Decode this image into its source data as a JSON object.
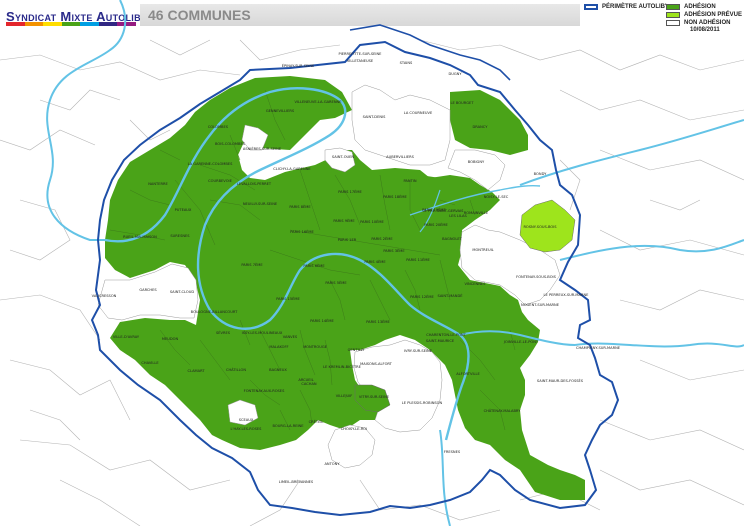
{
  "header": {
    "logo_text": "Syndicat Mixte Autolib'",
    "title": "46 COMMUNES",
    "date": "10/08/2011"
  },
  "legend": {
    "perimeter_label": "PÉRIMÈTRE AUTOLIB'",
    "items": [
      {
        "label": "ADHÉSION",
        "color": "#4aa318"
      },
      {
        "label": "ADHÉSION PRÉVUE",
        "color": "#9ee41c"
      },
      {
        "label": "NON ADHÉSION",
        "color": "#ffffff"
      }
    ],
    "perimeter_color": "#1e4fa8"
  },
  "map": {
    "colors": {
      "adhesion": "#4aa318",
      "prevue": "#9ee41c",
      "river": "#63c3e6",
      "perimeter": "#1e4fa8",
      "border": "#9a9a9a"
    },
    "labels": [
      {
        "t": "PIERREFITTE-SUR-SEINE"
      },
      {
        "t": "VILLETANEUSE"
      },
      {
        "t": "STAINS"
      },
      {
        "t": "DUGNY"
      },
      {
        "t": "ÉPINAY-SUR-SEINE"
      },
      {
        "t": "GENNEVILLIERS"
      },
      {
        "t": "VILLENEUVE-LA-GARENNE"
      },
      {
        "t": "LE BOURGET"
      },
      {
        "t": "LA COURNEUVE"
      },
      {
        "t": "SAINT-DENIS"
      },
      {
        "t": "COLOMBES"
      },
      {
        "t": "BOIS-COLOMBES"
      },
      {
        "t": "ASNIÈRES-SUR-SEINE"
      },
      {
        "t": "DRANCY"
      },
      {
        "t": "AUBERVILLIERS"
      },
      {
        "t": "BOBIGNY"
      },
      {
        "t": "LA GARENNE-COLOMBES"
      },
      {
        "t": "SAINT-OUEN"
      },
      {
        "t": "CLICHY-LA-GARENNE"
      },
      {
        "t": "COURBEVOIE"
      },
      {
        "t": "NANTERRE"
      },
      {
        "t": "LEVALLOIS-PERRET"
      },
      {
        "t": "PANTIN"
      },
      {
        "t": "BONDY"
      },
      {
        "t": "NEUILLY-SUR-SEINE"
      },
      {
        "t": "PARIS 17ÈME"
      },
      {
        "t": "PARIS 18ÈME"
      },
      {
        "t": "PARIS 19ÈME"
      },
      {
        "t": "PUTEAUX"
      },
      {
        "t": "NOISY-LE-SEC"
      },
      {
        "t": "LE PRÉ-SAINT-GERVAIS"
      },
      {
        "t": "LES LILAS"
      },
      {
        "t": "ROMAINVILLE"
      },
      {
        "t": "PARIS 8ÈME"
      },
      {
        "t": "PARIS 9ÈME"
      },
      {
        "t": "PARIS 10ÈME"
      },
      {
        "t": "PARIS 20ÈME"
      },
      {
        "t": "SURESNES"
      },
      {
        "t": "RUEIL-MALMAISON"
      },
      {
        "t": "PARIS 16ÈME"
      },
      {
        "t": "PARIS 1ER"
      },
      {
        "t": "PARIS 2ÈME"
      },
      {
        "t": "PARIS 3ÈME"
      },
      {
        "t": "BAGNOLET"
      },
      {
        "t": "ROSNY-SOUS-BOIS"
      },
      {
        "t": "PARIS 7ÈME"
      },
      {
        "t": "PARIS 4ÈME"
      },
      {
        "t": "PARIS 11ÈME"
      },
      {
        "t": "MONTREUIL"
      },
      {
        "t": "FONTENAY-SOUS-BOIS"
      },
      {
        "t": "PARIS 6ÈME"
      },
      {
        "t": "PARIS 5ÈME"
      },
      {
        "t": "VINCENNES"
      },
      {
        "t": "GARCHES"
      },
      {
        "t": "SAINT-CLOUD"
      },
      {
        "t": "PARIS 15ÈME"
      },
      {
        "t": "PARIS 12ÈME"
      },
      {
        "t": "SAINT-MANDÉ"
      },
      {
        "t": "LE PERREUX-SUR-MARNE"
      },
      {
        "t": "VAUCRESSON"
      },
      {
        "t": "BOULOGNE-BILLANCOURT"
      },
      {
        "t": "PARIS 14ÈME"
      },
      {
        "t": "PARIS 13ÈME"
      },
      {
        "t": "NOGENT-SUR-MARNE"
      },
      {
        "t": "SÈVRES"
      },
      {
        "t": "ISSY-LES-MOULINEAUX"
      },
      {
        "t": "VANVES"
      },
      {
        "t": "CHARENTON-LE-PONT"
      },
      {
        "t": "SAINT-MAURICE"
      },
      {
        "t": "JOINVILLE-LE-PONT"
      },
      {
        "t": "VILLE-D'AVRAY"
      },
      {
        "t": "MEUDON"
      },
      {
        "t": "MALAKOFF"
      },
      {
        "t": "MONTROUGE"
      },
      {
        "t": "GENTILLY"
      },
      {
        "t": "IVRY-SUR-SEINE"
      },
      {
        "t": "CHAMPIGNY-SUR-MARNE"
      },
      {
        "t": "CHAVILLE"
      },
      {
        "t": "CLAMART"
      },
      {
        "t": "CHÂTILLON"
      },
      {
        "t": "BAGNEUX"
      },
      {
        "t": "ARCUEIL"
      },
      {
        "t": "LE KREMLIN-BICÊTRE"
      },
      {
        "t": "MAISONS-ALFORT"
      },
      {
        "t": "ALFORTVILLE"
      },
      {
        "t": "SAINT-MAUR-DES-FOSSÉS"
      },
      {
        "t": "FONTENAY-AUX-ROSES"
      },
      {
        "t": "CACHAN"
      },
      {
        "t": "VILLEJUIF"
      },
      {
        "t": "VITRY-SUR-SEINE"
      },
      {
        "t": "LE PLESSIS-ROBINSON"
      },
      {
        "t": "SCEAUX"
      },
      {
        "t": "BOURG-LA-REINE"
      },
      {
        "t": "CRÉTEIL"
      },
      {
        "t": "CHÂTENAY-MALABRY"
      },
      {
        "t": "L'HAY-LES-ROSES"
      },
      {
        "t": "CHOISY-LE-ROI"
      },
      {
        "t": "FRESNES"
      },
      {
        "t": "ANTONY"
      },
      {
        "t": "LIMEIL-BRÉVANNES"
      }
    ]
  }
}
